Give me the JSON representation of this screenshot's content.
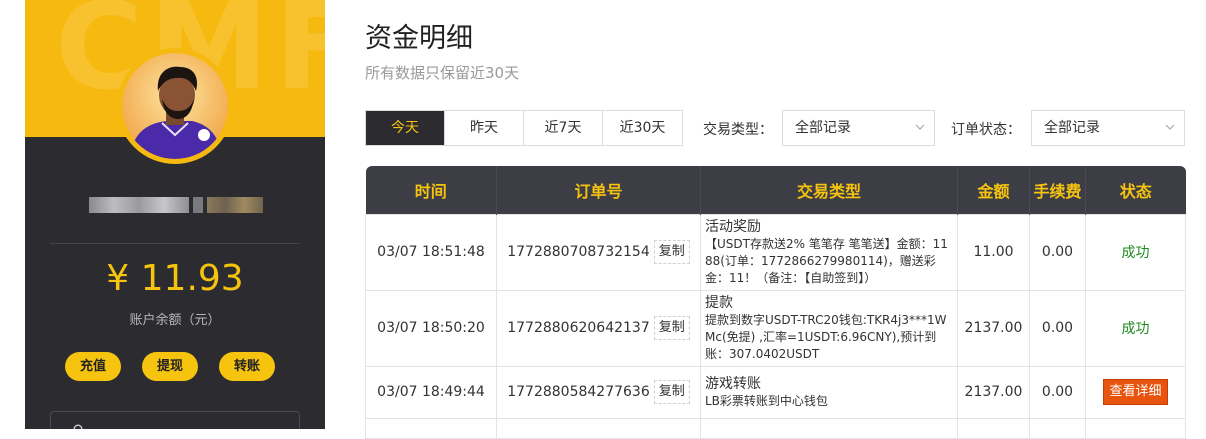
{
  "sidebar": {
    "watermark": "CMF",
    "balance": "¥ 11.93",
    "balance_label": "账户余额（元）",
    "actions": [
      {
        "label": "充值"
      },
      {
        "label": "提现"
      },
      {
        "label": "转账"
      }
    ]
  },
  "main": {
    "title": "资金明细",
    "subtitle": "所有数据只保留近30天",
    "date_tabs": [
      {
        "label": "今天",
        "active": true
      },
      {
        "label": "昨天",
        "active": false
      },
      {
        "label": "近7天",
        "active": false
      },
      {
        "label": "近30天",
        "active": false
      }
    ],
    "filters": {
      "trade_type_label": "交易类型：",
      "trade_type_value": "全部记录",
      "order_status_label": "订单状态：",
      "order_status_value": "全部记录"
    },
    "table": {
      "headers": [
        "时间",
        "订单号",
        "交易类型",
        "金额",
        "手续费",
        "状态"
      ],
      "copy_label": "复制",
      "rows": [
        {
          "time": "03/07 18:51:48",
          "order_no": "1772880708732154",
          "type_title": "活动奖励",
          "type_desc": "【USDT存款送2% 笔笔存 笔笔送】金额：1188(订单：1772866279980114)，赠送彩金：11！（备注：【自助签到】）",
          "amount": "11.00",
          "fee": "0.00",
          "status": "成功"
        },
        {
          "time": "03/07 18:50:20",
          "order_no": "1772880620642137",
          "type_title": "提款",
          "type_desc": "提款到数字USDT-TRC20钱包:TKR4j3***1WMc(免提) ,汇率=1USDT:6.96CNY),预计到账：307.0402USDT",
          "amount": "2137.00",
          "fee": "0.00",
          "status": "成功"
        },
        {
          "time": "03/07 18:49:44",
          "order_no": "1772880584277636",
          "type_title": "游戏转账",
          "type_desc": "LB彩票转账到中心钱包",
          "amount": "2137.00",
          "fee": "0.00",
          "status": "查看详细"
        }
      ]
    }
  },
  "colors": {
    "accent": "#f6c30f",
    "sidebar_bg": "#2c2c30",
    "header_bg": "#3d3d45",
    "success": "#1e8a1e",
    "detail_btn": "#e8530e"
  },
  "icons": [
    "search-icon",
    "chevron-down-icon",
    "avatar"
  ]
}
